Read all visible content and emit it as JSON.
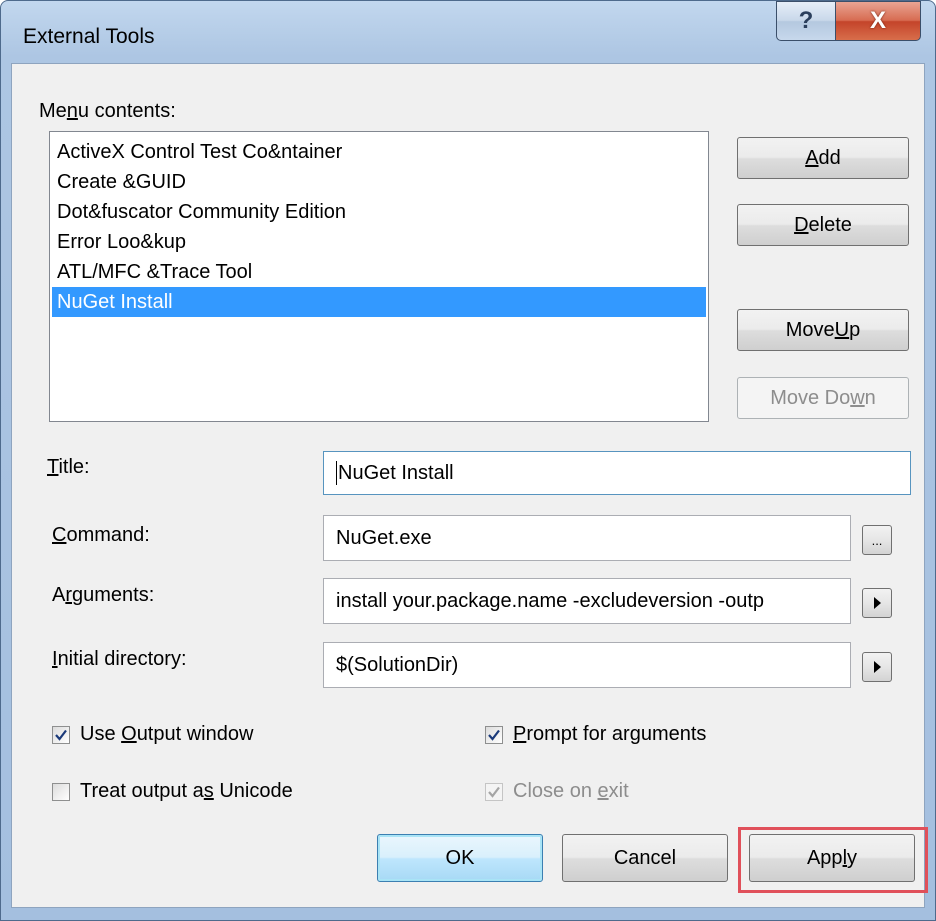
{
  "window": {
    "title": "External Tools",
    "help_label": "?",
    "close_label": "X"
  },
  "menu_contents": {
    "label_pre": "Me",
    "label_u": "n",
    "label_post": "u contents:",
    "items": [
      "ActiveX Control Test Co&ntainer",
      "Create &GUID",
      "Dot&fuscator Community Edition",
      "Error Loo&kup",
      "ATL/MFC &Trace Tool",
      "NuGet Install"
    ],
    "selected": "NuGet Install"
  },
  "side_buttons": {
    "add": {
      "u": "A",
      "rest": "dd"
    },
    "delete": {
      "u": "D",
      "rest": "elete"
    },
    "move_up": {
      "pre": "Move ",
      "u": "U",
      "rest": "p"
    },
    "move_down": {
      "pre": "Move Do",
      "u": "w",
      "rest": "n"
    }
  },
  "fields": {
    "title": {
      "u": "T",
      "rest": "itle:",
      "value": "NuGet Install"
    },
    "command": {
      "u": "C",
      "rest": "ommand:",
      "value": "NuGet.exe",
      "browse_label": "..."
    },
    "arguments": {
      "pre": "A",
      "u": "r",
      "rest": "guments:",
      "value": "install your.package.name -excludeversion -outp"
    },
    "initial_directory": {
      "u": "I",
      "rest": "nitial directory:",
      "value": "$(SolutionDir)"
    }
  },
  "options": {
    "use_output_window": {
      "pre": "Use ",
      "u": "O",
      "rest": "utput window",
      "checked": true,
      "enabled": true
    },
    "treat_unicode": {
      "pre": "Treat output a",
      "u": "s",
      "rest": " Unicode",
      "checked": false,
      "enabled": true
    },
    "prompt_arguments": {
      "pre": "",
      "u": "P",
      "rest": "rompt for arguments",
      "checked": true,
      "enabled": true
    },
    "close_on_exit": {
      "pre": "Close on ",
      "u": "e",
      "rest": "xit",
      "checked": true,
      "enabled": false
    }
  },
  "footer": {
    "ok_label": "OK",
    "cancel_label": "Cancel",
    "apply": {
      "pre": "App",
      "u": "l",
      "rest": "y"
    }
  },
  "colors": {
    "selection": "#3399ff",
    "highlight_box": "#e0505a"
  }
}
